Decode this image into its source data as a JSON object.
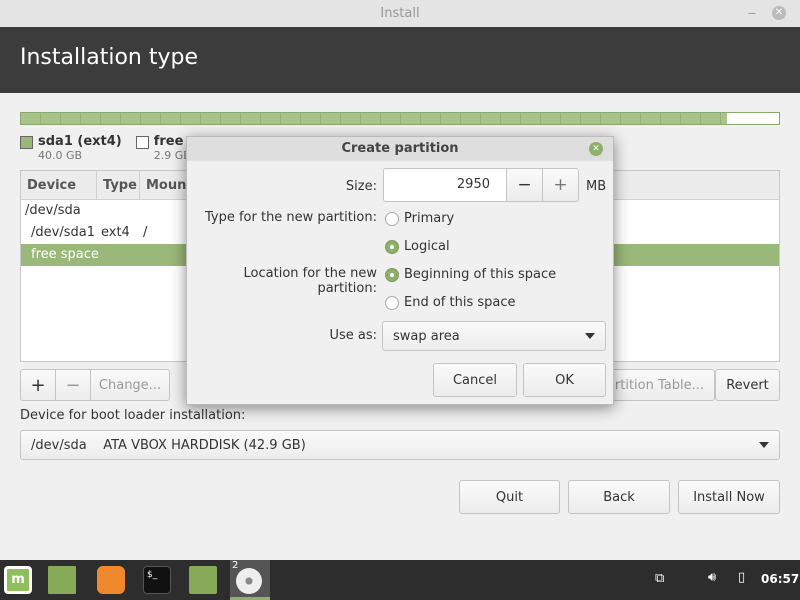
{
  "window": {
    "title": "Install",
    "header": "Installation type"
  },
  "partitions": {
    "legend": [
      {
        "name": "sda1 (ext4)",
        "size": "40.0 GB",
        "color": "#9ab87a"
      },
      {
        "name": "free space",
        "size": "2.9 GB",
        "color": "#ffffff"
      }
    ],
    "used_fraction": 0.932
  },
  "table": {
    "columns": [
      "Device",
      "Type",
      "Mount"
    ],
    "rows": [
      {
        "device": "/dev/sda",
        "type": "",
        "mount": ""
      },
      {
        "device": "/dev/sda1",
        "type": "ext4",
        "mount": "/"
      },
      {
        "device": "free space",
        "type": "",
        "mount": "",
        "selected": true
      }
    ]
  },
  "toolbar": {
    "add": "+",
    "remove": "−",
    "change": "Change...",
    "new_table": "New Partition Table...",
    "revert": "Revert"
  },
  "bootloader": {
    "label": "Device for boot loader installation:",
    "value": "/dev/sda    ATA VBOX HARDDISK (42.9 GB)"
  },
  "buttons": {
    "quit": "Quit",
    "back": "Back",
    "install": "Install Now"
  },
  "dialog": {
    "title": "Create partition",
    "size_label": "Size:",
    "size_value": "2950",
    "unit": "MB",
    "minus": "−",
    "plus": "+",
    "type_label": "Type for the new partition:",
    "type_options": [
      "Primary",
      "Logical"
    ],
    "type_selected": "Logical",
    "location_label": "Location for the new partition:",
    "location_options": [
      "Beginning of this space",
      "End of this space"
    ],
    "location_selected": "Beginning of this space",
    "use_as_label": "Use as:",
    "use_as_value": "swap area",
    "cancel": "Cancel",
    "ok": "OK"
  },
  "taskbar": {
    "items": [
      "mint-menu-icon",
      "show-desktop-icon",
      "firefox-icon",
      "terminal-icon",
      "files-icon",
      "installer-disc-icon"
    ],
    "badge": "2",
    "clock": "06:57"
  },
  "colors": {
    "accent": "#9ab87a",
    "header": "#3c3c3c",
    "taskbar": "#2d2d2d"
  }
}
